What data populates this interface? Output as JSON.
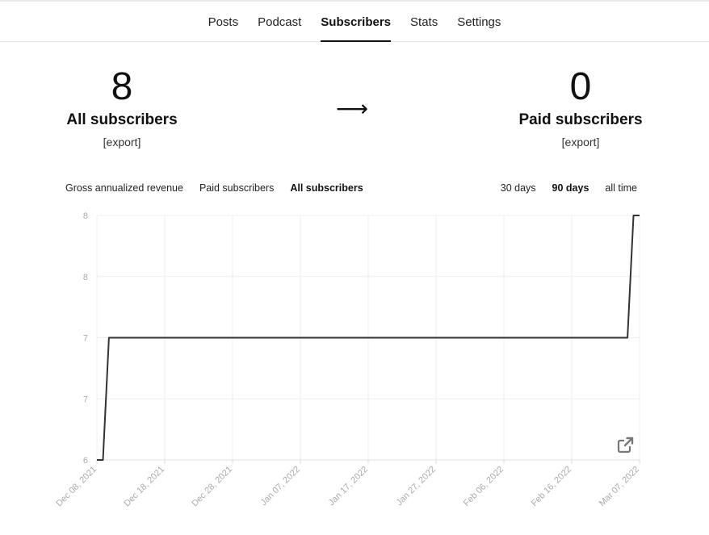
{
  "nav": {
    "tabs": [
      {
        "label": "Posts"
      },
      {
        "label": "Podcast"
      },
      {
        "label": "Subscribers",
        "active": true
      },
      {
        "label": "Stats"
      },
      {
        "label": "Settings"
      }
    ]
  },
  "stats": {
    "all": {
      "value": "8",
      "label": "All subscribers",
      "export": "[export]"
    },
    "arrow": "⟶",
    "paid": {
      "value": "0",
      "label": "Paid subscribers",
      "export": "[export]"
    }
  },
  "metric_tabs": [
    {
      "label": "Gross annualized revenue"
    },
    {
      "label": "Paid subscribers"
    },
    {
      "label": "All subscribers",
      "active": true
    }
  ],
  "range_tabs": [
    {
      "label": "30 days"
    },
    {
      "label": "90 days",
      "active": true
    },
    {
      "label": "all time"
    }
  ],
  "chart_data": {
    "type": "line",
    "series": [
      {
        "x": [
          "2021-12-08",
          "2021-12-09",
          "2021-12-10",
          "2022-03-06",
          "2022-03-07",
          "2022-03-08"
        ],
        "values": [
          6,
          6,
          7,
          7,
          8,
          8
        ]
      }
    ],
    "ylim": [
      6,
      8
    ],
    "yticks": [
      6,
      7,
      7,
      8,
      8
    ],
    "xticks": [
      "Dec 08, 2021",
      "Dec 18, 2021",
      "Dec 28, 2021",
      "Jan 07, 2022",
      "Jan 17, 2022",
      "Jan 27, 2022",
      "Feb 06, 2022",
      "Feb 16, 2022",
      "Mar 07, 2022"
    ],
    "grid": true,
    "line_color": "#333333"
  },
  "icons": {
    "external": "external-link-icon"
  }
}
